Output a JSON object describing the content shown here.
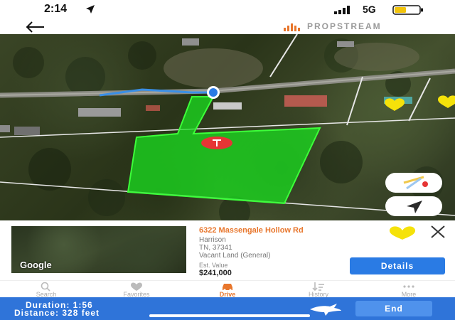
{
  "status_bar": {
    "time": "2:14",
    "network": "5G"
  },
  "header": {
    "brand": "PROPSTREAM"
  },
  "card": {
    "address": "6322 Massengale Hollow Rd",
    "city": "Harrison",
    "state_zip": "TN, 37341",
    "property_type": "Vacant Land (General)",
    "est_label": "Est. Value",
    "est_value": "$241,000",
    "details_label": "Details",
    "thumbnail_logo": "Google"
  },
  "tabs": [
    {
      "label": "Search",
      "icon": "search-icon",
      "active": false
    },
    {
      "label": "Favorites",
      "icon": "heart-icon",
      "active": false
    },
    {
      "label": "Drive",
      "icon": "car-icon",
      "active": true
    },
    {
      "label": "History",
      "icon": "history-icon",
      "active": false
    },
    {
      "label": "More",
      "icon": "more-icon",
      "active": false
    }
  ],
  "nav": {
    "duration": "Duration:  1:56",
    "distance": "Distance:  328 feet",
    "end_label": "End"
  },
  "colors": {
    "accent": "#e8762c",
    "primary": "#2a7be4",
    "nav_bar": "#2f74d9",
    "parcel": "#19e01f",
    "favorite": "#f5e20a"
  }
}
